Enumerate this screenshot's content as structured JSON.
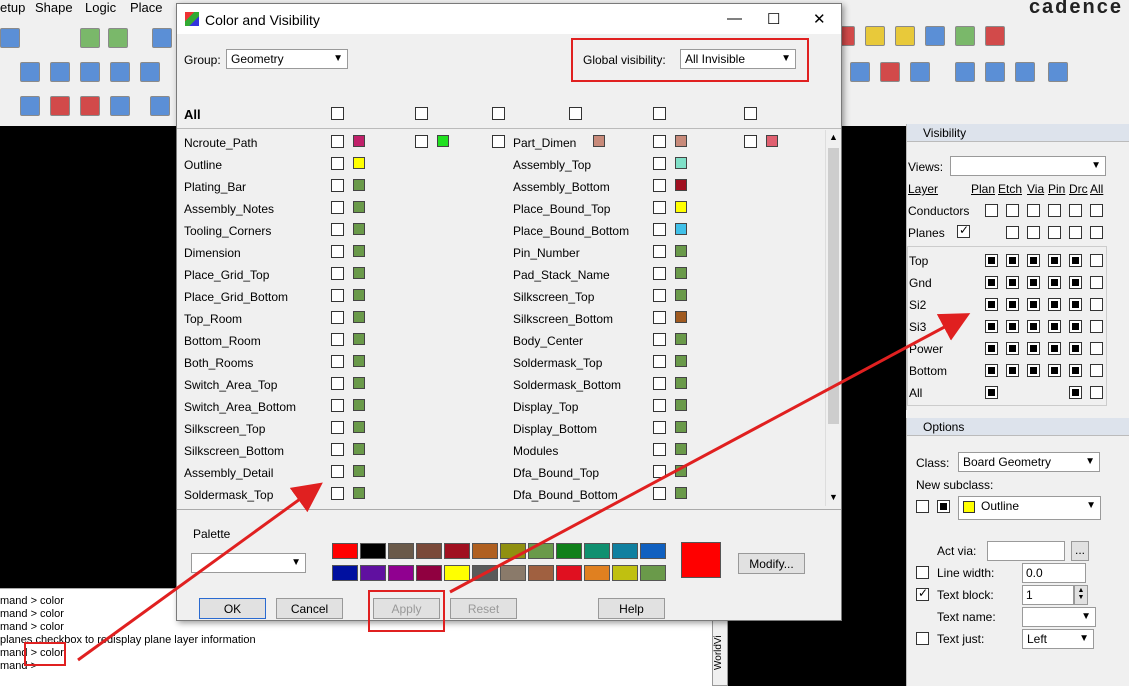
{
  "menu": [
    "etup",
    "Shape",
    "Logic",
    "Place"
  ],
  "brand": "cadence",
  "dialog": {
    "title": "Color and Visibility",
    "group_label": "Group:",
    "group_value": "Geometry",
    "global_vis_label": "Global visibility:",
    "global_vis_value": "All Invisible",
    "all_label": "All",
    "top_extra_label": "Part_Dimen",
    "left_rows": [
      "Ncroute_Path",
      "Outline",
      "Plating_Bar",
      "Assembly_Notes",
      "Tooling_Corners",
      "Dimension",
      "Place_Grid_Top",
      "Place_Grid_Bottom",
      "Top_Room",
      "Bottom_Room",
      "Both_Rooms",
      "Switch_Area_Top",
      "Switch_Area_Bottom",
      "Silkscreen_Top",
      "Silkscreen_Bottom",
      "Assembly_Detail",
      "Soldermask_Top"
    ],
    "right_rows": [
      "Part_Dimen",
      "Assembly_Top",
      "Assembly_Bottom",
      "Place_Bound_Top",
      "Place_Bound_Bottom",
      "Pin_Number",
      "Pad_Stack_Name",
      "Silkscreen_Top",
      "Silkscreen_Bottom",
      "Body_Center",
      "Soldermask_Top",
      "Soldermask_Bottom",
      "Display_Top",
      "Display_Bottom",
      "Modules",
      "Dfa_Bound_Top",
      "Dfa_Bound_Bottom"
    ],
    "left_colors": [
      "#c0206a",
      "#ffff00",
      "#6a9a4a",
      "#6a9a4a",
      "#6a9a4a",
      "#6a9a4a",
      "#6a9a4a",
      "#6a9a4a",
      "#6a9a4a",
      "#6a9a4a",
      "#6a9a4a",
      "#6a9a4a",
      "#6a9a4a",
      "#6a9a4a",
      "#6a9a4a",
      "#6a9a4a",
      "#6a9a4a"
    ],
    "right_colors": [
      "#c88a7a",
      "#80e0c8",
      "#a01020",
      "#ffff00",
      "#40c0e8",
      "#6a9a4a",
      "#6a9a4a",
      "#6a9a4a",
      "#a05a20",
      "#6a9a4a",
      "#6a9a4a",
      "#6a9a4a",
      "#6a9a4a",
      "#6a9a4a",
      "#6a9a4a",
      "#6a9a4a",
      "#6a9a4a"
    ],
    "palette_label": "Palette",
    "palette_row1": [
      "#ff0000",
      "#000000",
      "#6a5a4a",
      "#7a4a3a",
      "#a01020",
      "#b06020",
      "#909010",
      "#6a9a4a",
      "#10801a",
      "#109070",
      "#1080a0",
      "#1060c0"
    ],
    "palette_row2": [
      "#0010a0",
      "#6010a0",
      "#900090",
      "#900040",
      "#ffff00",
      "#5a5a5a",
      "#8a7a6a",
      "#a06040",
      "#e01020",
      "#e08020",
      "#c0c010",
      "#6a9a4a"
    ],
    "selected_color": "#ff0000",
    "modify_label": "Modify...",
    "ok_label": "OK",
    "cancel_label": "Cancel",
    "apply_label": "Apply",
    "reset_label": "Reset",
    "help_label": "Help"
  },
  "visibility": {
    "title": "Visibility",
    "views_label": "Views:",
    "headers": [
      "Layer",
      "Plan",
      "Etch",
      "Via",
      "Pin",
      "Drc",
      "All"
    ],
    "conductors": "Conductors",
    "planes": "Planes",
    "layers": [
      "Top",
      "Gnd",
      "Si2",
      "Si3",
      "Power",
      "Bottom",
      "All"
    ]
  },
  "options": {
    "title": "Options",
    "class_label": "Class:",
    "class_value": "Board Geometry",
    "new_subclass_label": "New subclass:",
    "subclass_value": "Outline",
    "act_via_label": "Act via:",
    "line_width_label": "Line width:",
    "line_width_value": "0.0",
    "text_block_label": "Text block:",
    "text_block_value": "1",
    "text_name_label": "Text name:",
    "text_just_label": "Text just:",
    "text_just_value": "Left"
  },
  "command_lines": [
    "mand > color",
    "mand > color",
    "mand > color",
    "planes checkbox to redisplay plane layer information",
    "mand > color",
    "mand >"
  ],
  "worldview_label": "WorldVi"
}
